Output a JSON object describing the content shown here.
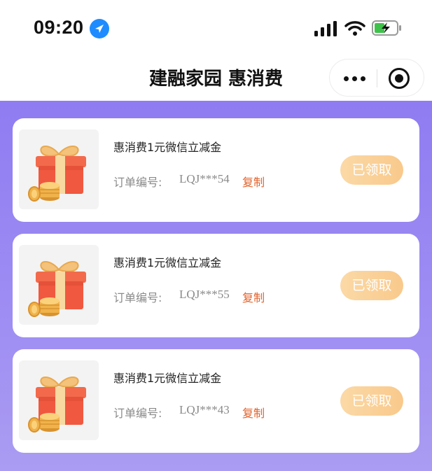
{
  "status_bar": {
    "time": "09:20",
    "icons": [
      "location-arrow-icon",
      "signal-icon",
      "wifi-icon",
      "battery-charging-icon"
    ]
  },
  "nav": {
    "title": "建融家园 惠消费",
    "icons": [
      "more-dots-icon",
      "close-circle-icon"
    ]
  },
  "colors": {
    "background_purple": "#8f7cf2",
    "copy_link": "#e2622b",
    "claimed_button": "#f9c98b"
  },
  "cards": [
    {
      "title": "惠消费1元微信立减金",
      "order_label": "订单编号:",
      "order_no": "LQJ***54",
      "copy_label": "复制",
      "button_label": "已领取",
      "icon": "gift-box-coins-icon"
    },
    {
      "title": "惠消费1元微信立减金",
      "order_label": "订单编号:",
      "order_no": "LQJ***55",
      "copy_label": "复制",
      "button_label": "已领取",
      "icon": "gift-box-coins-icon"
    },
    {
      "title": "惠消费1元微信立减金",
      "order_label": "订单编号:",
      "order_no": "LQJ***43",
      "copy_label": "复制",
      "button_label": "已领取",
      "icon": "gift-box-coins-icon"
    }
  ]
}
